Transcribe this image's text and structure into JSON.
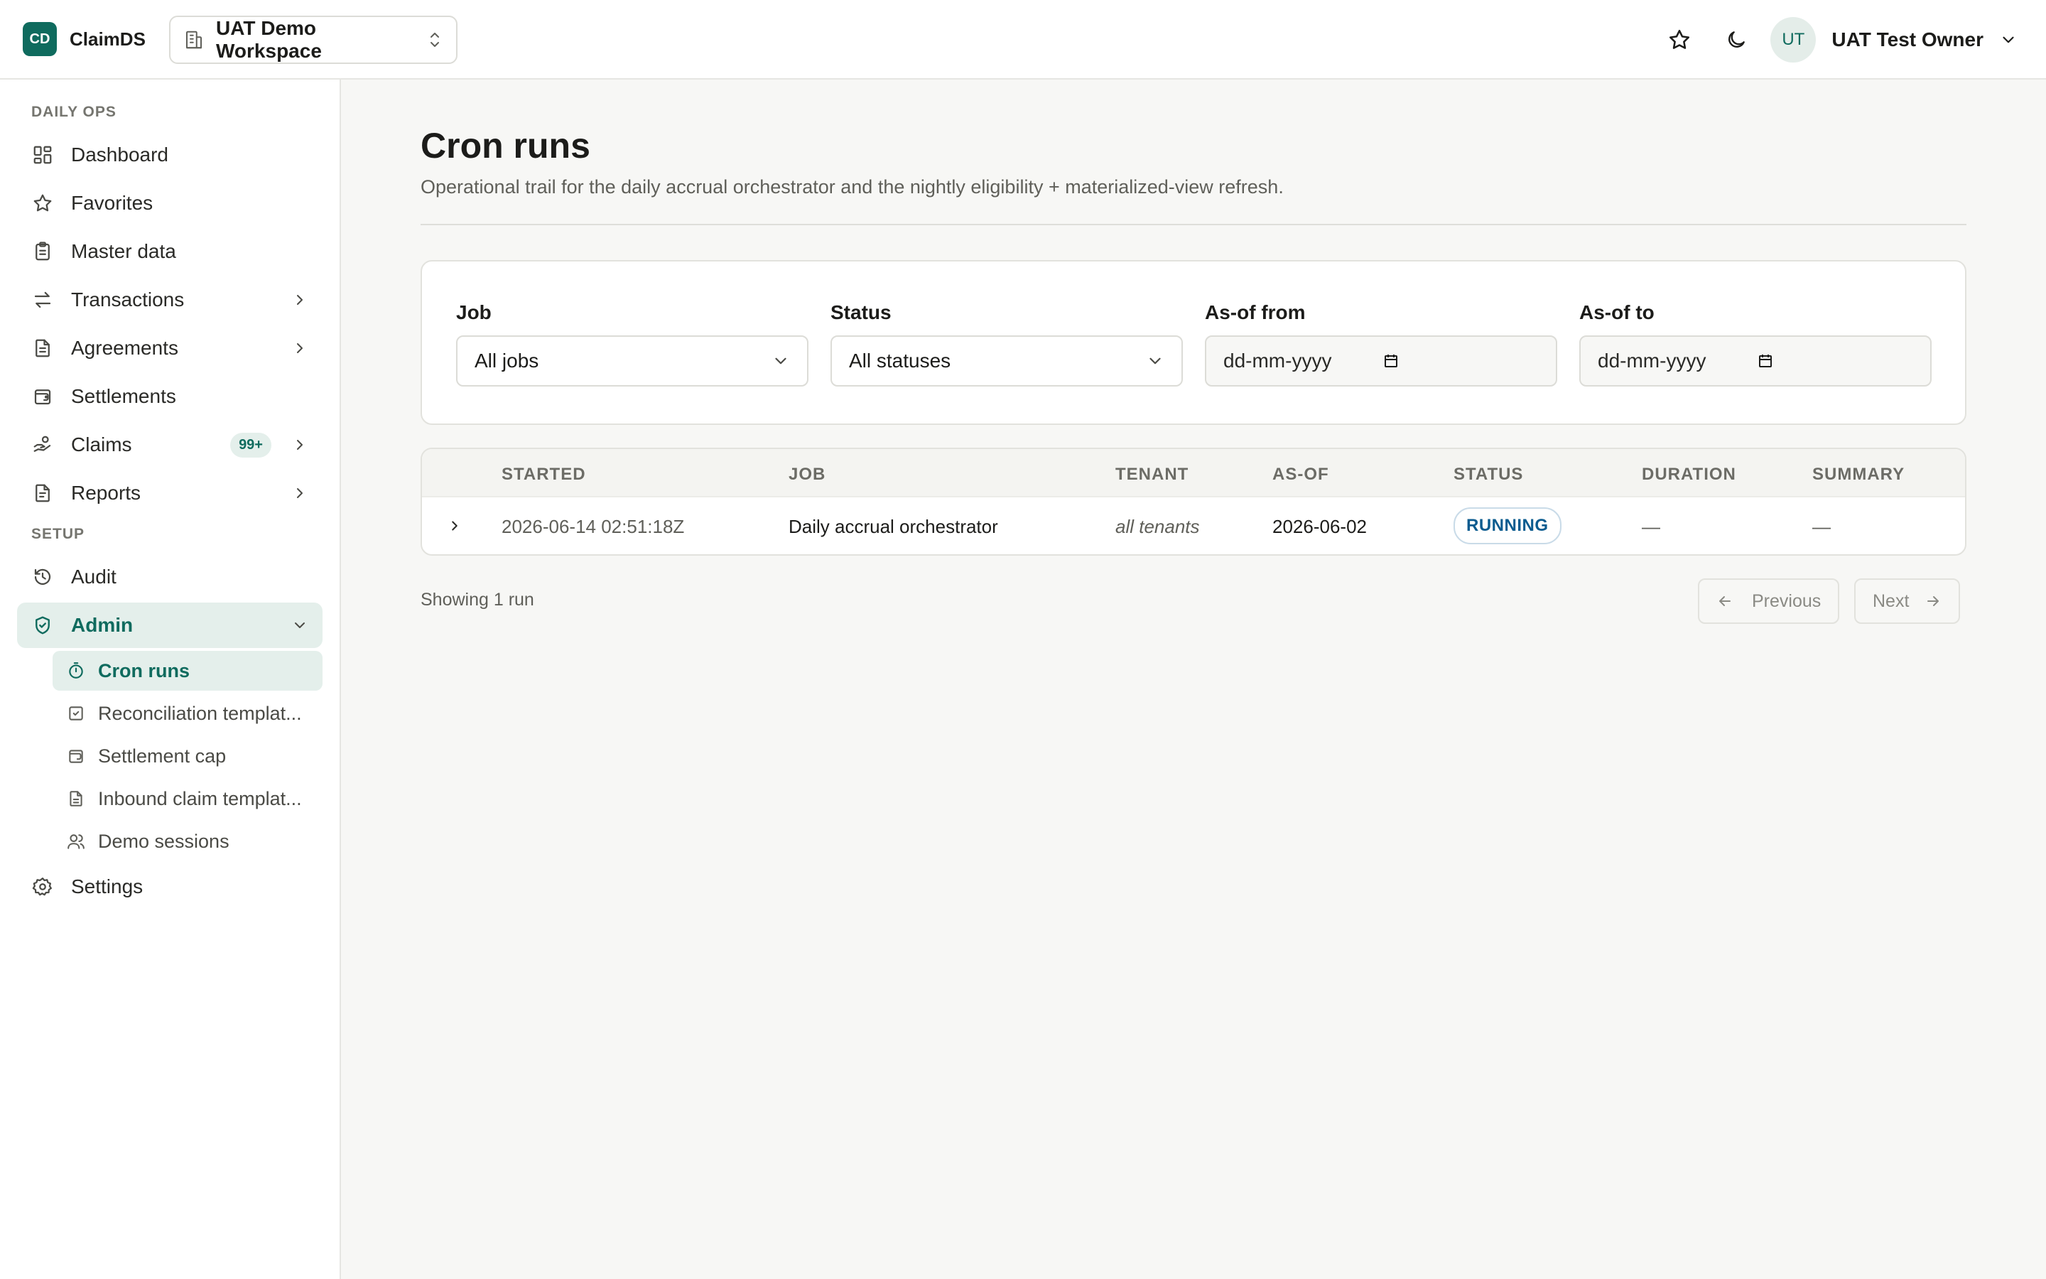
{
  "app": {
    "logo_text": "CD",
    "name": "ClaimDS"
  },
  "workspace": {
    "label": "UAT Demo Workspace"
  },
  "user": {
    "initials": "UT",
    "name": "UAT Test Owner"
  },
  "sidebar": {
    "sections": [
      {
        "label": "DAILY OPS"
      },
      {
        "label": "SETUP"
      }
    ],
    "items": [
      {
        "label": "Dashboard",
        "icon": "dashboard-icon"
      },
      {
        "label": "Favorites",
        "icon": "star-icon"
      },
      {
        "label": "Master data",
        "icon": "clipboard-icon"
      },
      {
        "label": "Transactions",
        "icon": "arrows-icon",
        "has_children": true
      },
      {
        "label": "Agreements",
        "icon": "document-icon",
        "has_children": true
      },
      {
        "label": "Settlements",
        "icon": "wallet-icon"
      },
      {
        "label": "Claims",
        "icon": "hand-coins-icon",
        "badge": "99+",
        "has_children": true
      },
      {
        "label": "Reports",
        "icon": "report-icon",
        "has_children": true
      },
      {
        "label": "Audit",
        "icon": "history-icon"
      },
      {
        "label": "Admin",
        "icon": "shield-icon",
        "expanded": true,
        "active": true
      },
      {
        "label": "Settings",
        "icon": "gear-icon"
      }
    ],
    "admin_children": [
      {
        "label": "Cron runs",
        "icon": "timer-icon",
        "active": true
      },
      {
        "label": "Reconciliation templat...",
        "icon": "check-square-icon"
      },
      {
        "label": "Settlement cap",
        "icon": "wallet-icon"
      },
      {
        "label": "Inbound claim templat...",
        "icon": "file-icon"
      },
      {
        "label": "Demo sessions",
        "icon": "users-icon"
      }
    ]
  },
  "page": {
    "title": "Cron runs",
    "subtitle": "Operational trail for the daily accrual orchestrator and the nightly eligibility + materialized-view refresh."
  },
  "filters": {
    "job": {
      "label": "Job",
      "value": "All jobs"
    },
    "status": {
      "label": "Status",
      "value": "All statuses"
    },
    "as_of_from": {
      "label": "As-of from",
      "placeholder": "dd-mm-yyyy"
    },
    "as_of_to": {
      "label": "As-of to",
      "placeholder": "dd-mm-yyyy"
    }
  },
  "table": {
    "columns": [
      "STARTED",
      "JOB",
      "TENANT",
      "AS-OF",
      "STATUS",
      "DURATION",
      "SUMMARY"
    ],
    "rows": [
      {
        "started": "2026-06-14 02:51:18Z",
        "job": "Daily accrual orchestrator",
        "tenant": "all tenants",
        "as_of": "2026-06-02",
        "status": "RUNNING",
        "duration": "—",
        "summary": "—"
      }
    ]
  },
  "footer": {
    "showing": "Showing 1 run",
    "previous_label": "Previous",
    "next_label": "Next"
  },
  "colors": {
    "accent": "#0f6b5e",
    "accent_bg": "#e4efeb",
    "status_running": "#0b5b8f"
  }
}
